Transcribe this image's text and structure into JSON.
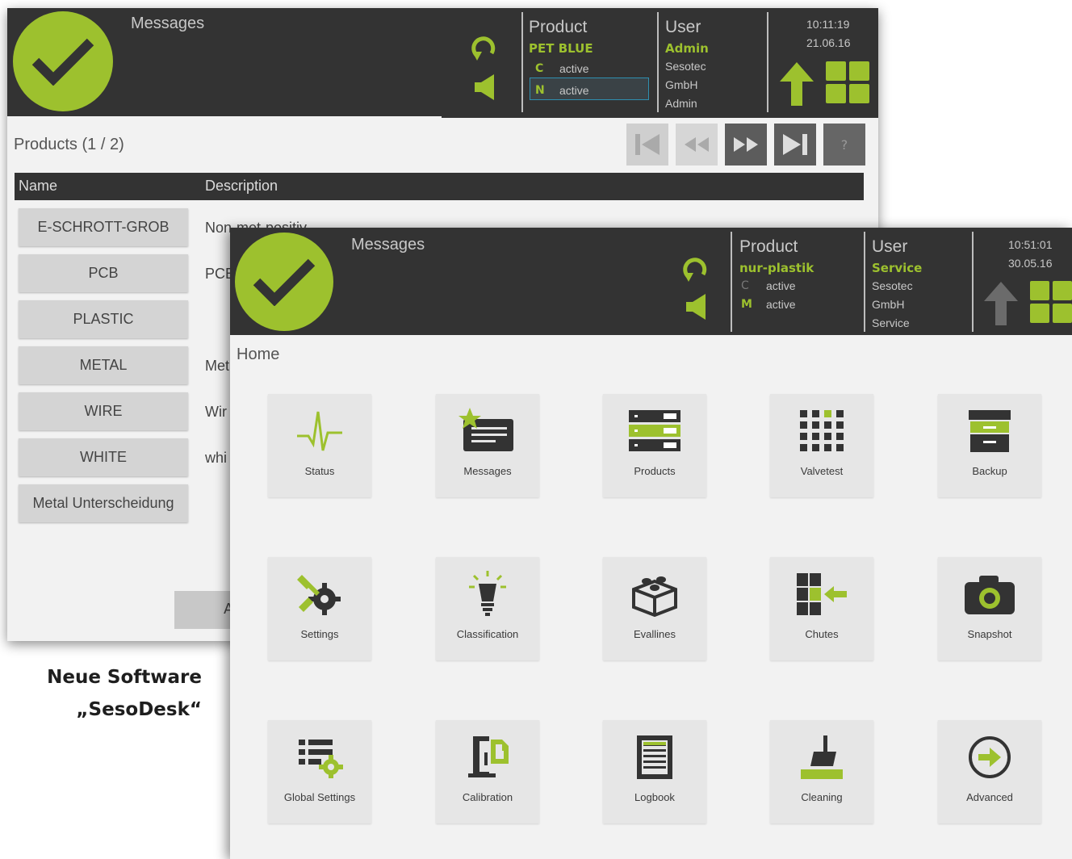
{
  "colors": {
    "accent": "#9dc12e",
    "header_bg": "#333333",
    "panel_bg": "#f2f2f2",
    "tile_bg": "#e6e6e6",
    "selection": "#2f8fb0"
  },
  "window1": {
    "header": {
      "messages_label": "Messages",
      "product_title": "Product",
      "product_name": "PET BLUE",
      "product_modes": [
        {
          "code": "C",
          "state": "active"
        },
        {
          "code": "N",
          "state": "active"
        }
      ],
      "user_title": "User",
      "user_role": "Admin",
      "user_lines": [
        "Sesotec",
        "GmbH",
        "Admin"
      ],
      "time": "10:11:19",
      "date": "21.06.16"
    },
    "page_title": "Products",
    "page_count": "(1 / 2)",
    "help_label": "?",
    "table": {
      "col_name": "Name",
      "col_description": "Description"
    },
    "products": [
      {
        "name": "E-SCHROTT-GROB",
        "description": "Non-met-positiv"
      },
      {
        "name": "PCB",
        "description": "PCB"
      },
      {
        "name": "PLASTIC",
        "description": ""
      },
      {
        "name": "METAL",
        "description": "Met"
      },
      {
        "name": "WIRE",
        "description": "Wir"
      },
      {
        "name": "WHITE",
        "description": "whi"
      },
      {
        "name": "Metal Unterscheidung",
        "description": ""
      }
    ],
    "bottom_button": "A"
  },
  "caption": {
    "line1": "Neue Software",
    "line2": "„SesoDesk“"
  },
  "window2": {
    "header": {
      "messages_label": "Messages",
      "product_title": "Product",
      "product_name": "nur-plastik",
      "product_modes": [
        {
          "code": "C",
          "state": "active"
        },
        {
          "code": "M",
          "state": "active"
        }
      ],
      "user_title": "User",
      "user_role": "Service",
      "user_lines": [
        "Sesotec",
        "GmbH",
        "Service"
      ],
      "time": "10:51:01",
      "date": "30.05.16"
    },
    "home_label": "Home",
    "tiles": [
      {
        "label": "Status",
        "icon": "pulse-icon"
      },
      {
        "label": "Messages",
        "icon": "message-star-icon"
      },
      {
        "label": "Products",
        "icon": "products-rack-icon"
      },
      {
        "label": "Valvetest",
        "icon": "valve-grid-icon"
      },
      {
        "label": "Backup",
        "icon": "archive-box-icon"
      },
      {
        "label": "Settings",
        "icon": "tools-gear-icon"
      },
      {
        "label": "Classification",
        "icon": "bulb-icon"
      },
      {
        "label": "Evallines",
        "icon": "brick-box-icon"
      },
      {
        "label": "Chutes",
        "icon": "chute-grid-icon"
      },
      {
        "label": "Snapshot",
        "icon": "camera-icon"
      },
      {
        "label": "Global Settings",
        "icon": "list-gear-icon"
      },
      {
        "label": "Calibration",
        "icon": "clamp-doc-icon"
      },
      {
        "label": "Logbook",
        "icon": "logbook-icon"
      },
      {
        "label": "Cleaning",
        "icon": "broom-icon"
      },
      {
        "label": "Advanced",
        "icon": "arrow-circle-icon"
      }
    ]
  }
}
